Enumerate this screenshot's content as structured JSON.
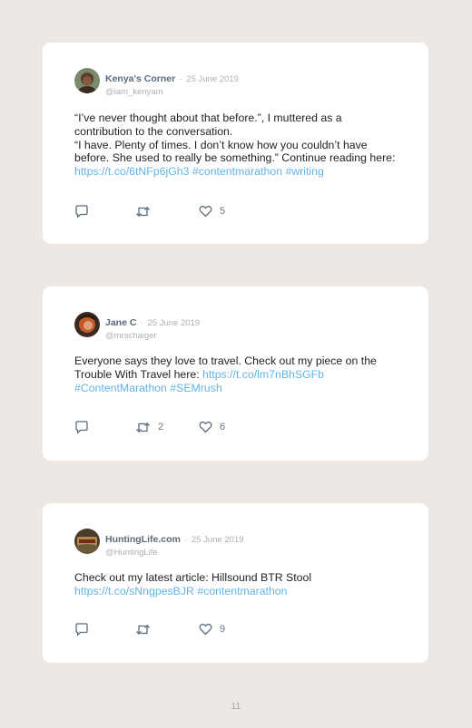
{
  "tweets": [
    {
      "author": "Kenya's Corner",
      "separator": "·",
      "date": "25 June 2019",
      "handle": "@iam_kenyam",
      "text_lines": [
        "“I’ve never thought about that before.”, I muttered as a contribution to the conversation.",
        "“I have. Plenty of times. I don’t know how you couldn’t have before. She used to really be something.” Continue reading here:"
      ],
      "links": [
        "https://t.co/6tNFp6jGh3",
        "#contentmarathon",
        "#writing"
      ],
      "retweets": "",
      "likes": "5",
      "avatar_color": "#5a3b2e"
    },
    {
      "author": "Jane C",
      "separator": "·",
      "date": "25 June 2019",
      "handle": "@mrschaiger",
      "text_lines": [
        "Everyone says they love to travel. Check out my piece on the Trouble With Travel here:"
      ],
      "links": [
        "https://t.co/lm7nBhSGFb",
        "#ContentMarathon",
        "#SEMrush"
      ],
      "retweets": "2",
      "likes": "6",
      "avatar_color": "#c25a2a"
    },
    {
      "author": "HuntingLife.com",
      "separator": "·",
      "date": "25 June 2019",
      "handle": "@HuntingLife",
      "text_lines": [
        "Check out my latest article: Hillsound BTR Stool"
      ],
      "links": [
        "https://t.co/sNngpesBJR",
        "#contentmarathon"
      ],
      "retweets": "",
      "likes": "9",
      "avatar_color": "#6b5a3a"
    }
  ],
  "page_number": "11",
  "colors": {
    "link": "#63b3e6",
    "background": "#ede8e3",
    "card": "#ffffff"
  }
}
